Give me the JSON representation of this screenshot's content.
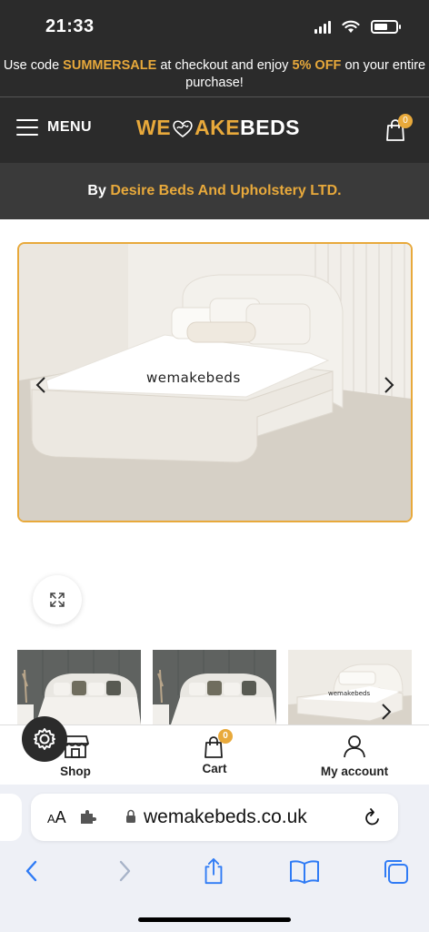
{
  "status_bar": {
    "time": "21:33"
  },
  "promo": {
    "text_before": "Use code ",
    "code": "SUMMERSALE",
    "text_middle": " at checkout and enjoy ",
    "discount": "5% OFF",
    "text_after": " on your entire purchase!"
  },
  "header": {
    "menu_label": "MENU",
    "logo_part1": "WE",
    "logo_part2": "AKE",
    "logo_part3": "BEDS",
    "cart_count": "0"
  },
  "byline": {
    "prefix": "By ",
    "brand": "Desire Beds And Upholstery LTD."
  },
  "product_image": {
    "watermark": "wemakebeds"
  },
  "thumbnail_watermark": "wemakebeds",
  "store_nav": {
    "items": [
      {
        "label": "Shop",
        "icon": "shop-icon"
      },
      {
        "label": "Cart",
        "icon": "cart-icon",
        "count": "0"
      },
      {
        "label": "My account",
        "icon": "user-icon"
      }
    ]
  },
  "browser": {
    "aa_label_small": "A",
    "aa_label_large": "A",
    "url": "wemakebeds.co.uk"
  },
  "colors": {
    "accent": "#e8a93b",
    "header_bg": "#2b2b2b",
    "ios_blue": "#2f7bf5"
  }
}
